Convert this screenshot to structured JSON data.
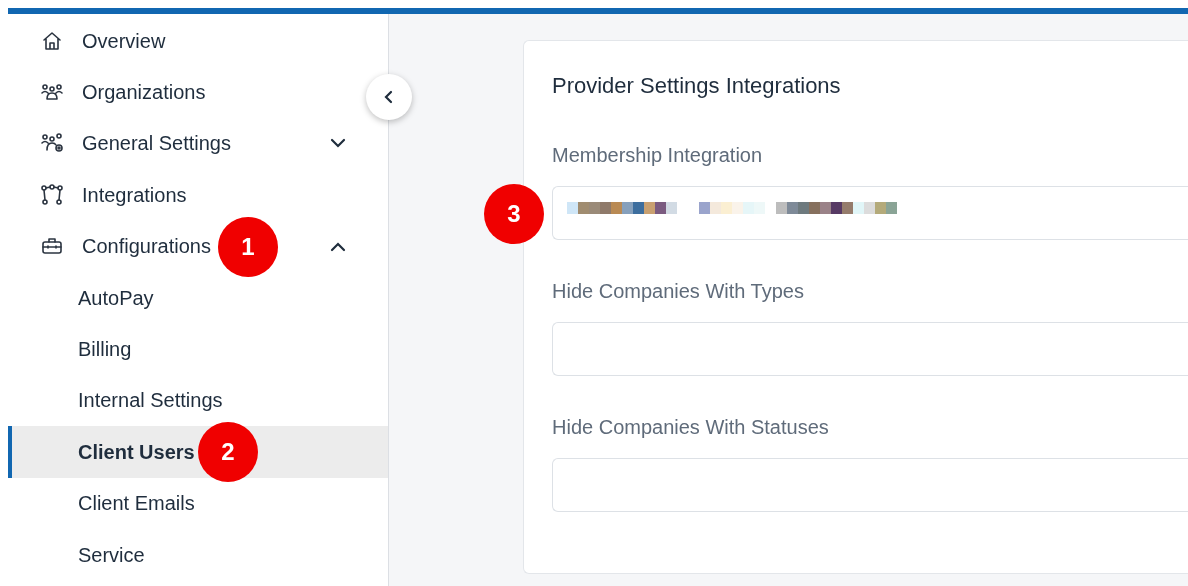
{
  "sidebar": {
    "items": [
      {
        "label": "Overview"
      },
      {
        "label": "Organizations"
      },
      {
        "label": "General Settings",
        "expanded": false
      },
      {
        "label": "Integrations"
      },
      {
        "label": "Configurations",
        "expanded": true,
        "callout": "1",
        "children": [
          {
            "label": "AutoPay",
            "selected": false
          },
          {
            "label": "Billing",
            "selected": false
          },
          {
            "label": "Internal Settings",
            "selected": false
          },
          {
            "label": "Client Users",
            "selected": true,
            "callout": "2"
          },
          {
            "label": "Client Emails",
            "selected": false
          },
          {
            "label": "Service",
            "selected": false
          }
        ]
      }
    ]
  },
  "card": {
    "title": "Provider Settings Integrations",
    "fields": [
      {
        "label": "Membership Integration",
        "redacted": true,
        "callout": "3"
      },
      {
        "label": "Hide Companies With Types",
        "redacted": false
      },
      {
        "label": "Hide Companies With Statuses",
        "redacted": false
      }
    ]
  }
}
